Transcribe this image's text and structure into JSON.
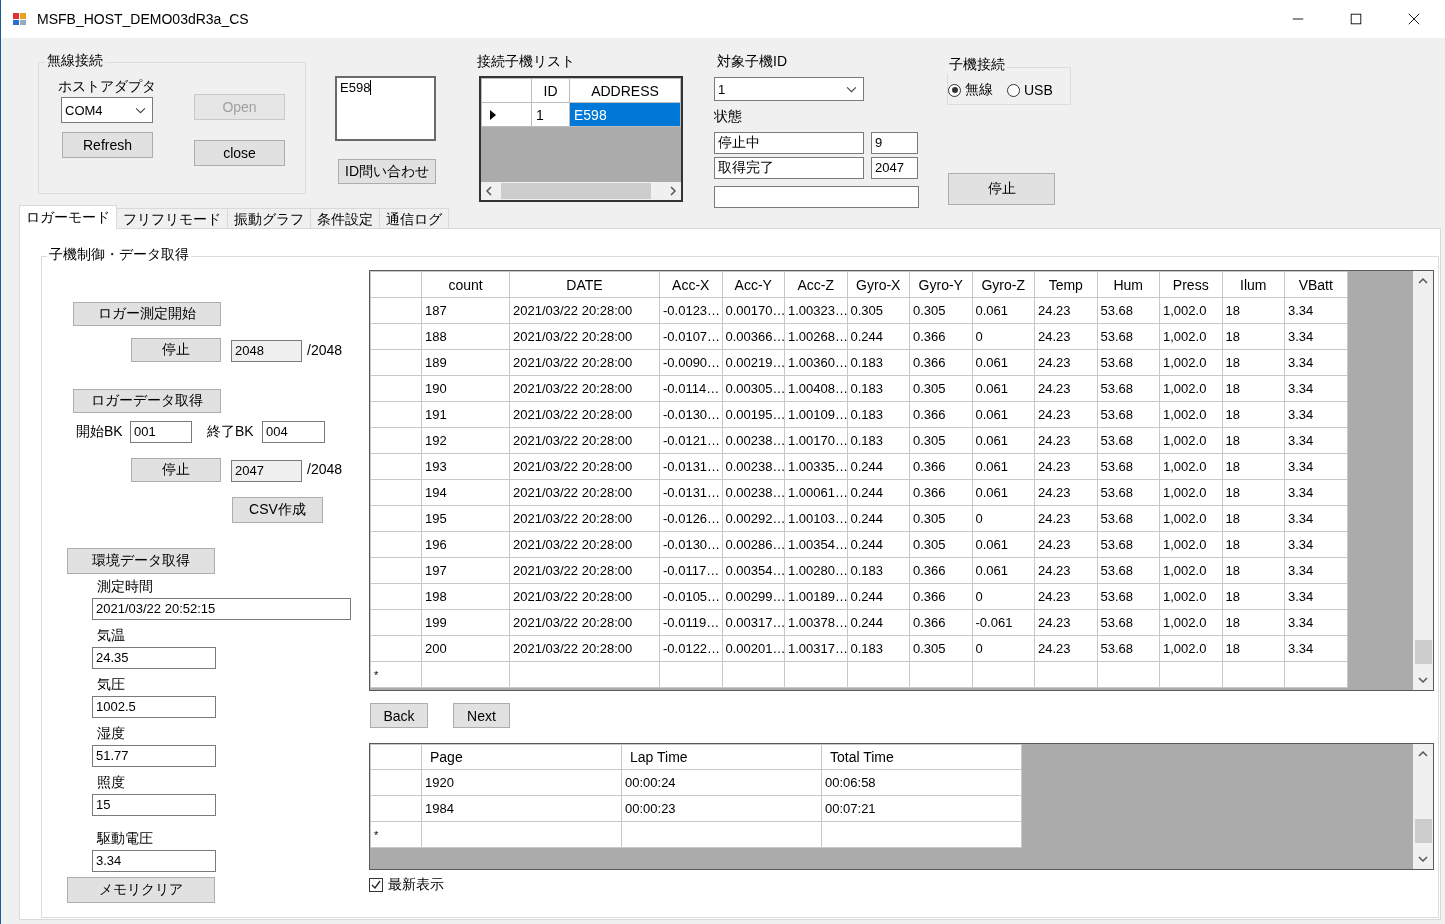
{
  "window": {
    "title": "MSFB_HOST_DEMO03dR3a_CS"
  },
  "wireless_group": {
    "title": "無線接続",
    "adapter_label": "ホストアダプタ",
    "port": "COM4",
    "refresh_button": "Refresh",
    "open_button": {
      "label": "Open",
      "disabled": true
    },
    "close_button": {
      "label": "close",
      "disabled": false
    }
  },
  "id_input": {
    "value": "E598"
  },
  "id_query_button": "ID問い合わせ",
  "device_list": {
    "title": "接続子機リスト",
    "columns": [
      "ID",
      "ADDRESS"
    ],
    "rows": [
      {
        "cells": [
          "1",
          "E598"
        ],
        "selected": true
      }
    ]
  },
  "target": {
    "label": "対象子機ID",
    "value": "1",
    "status_label": "状態",
    "status_fields": [
      {
        "text": "停止中",
        "count": "9"
      },
      {
        "text": "取得完了",
        "count": "2047"
      }
    ]
  },
  "connection": {
    "title": "子機接続",
    "options": [
      {
        "label": "無線",
        "selected": true
      },
      {
        "label": "USB",
        "selected": false
      }
    ]
  },
  "stop_button": "停止",
  "tabs": [
    {
      "label": "ロガーモード",
      "selected": true
    },
    {
      "label": "フリフリモード",
      "selected": false
    },
    {
      "label": "振動グラフ",
      "selected": false
    },
    {
      "label": "条件設定",
      "selected": false
    },
    {
      "label": "通信ログ",
      "selected": false
    }
  ],
  "logger": {
    "title": "子機制御・データ取得",
    "start_button": "ロガー測定開始",
    "stop_button_1": "停止",
    "progress_1": "2048",
    "total_1": "/2048",
    "fetch_button": "ロガーデータ取得",
    "start_bk_label": "開始BK",
    "start_bk": "001",
    "end_bk_label": "終了BK",
    "end_bk": "004",
    "stop_button_2": "停止",
    "progress_2": "2047",
    "total_2": "/2048",
    "csv_button": "CSV作成",
    "env_button": "環境データ取得",
    "env_fields": [
      {
        "label": "測定時間",
        "value": "2021/03/22 20:52:15",
        "kind": "wide"
      },
      {
        "label": "気温",
        "value": "24.35",
        "kind": "short"
      },
      {
        "label": "気圧",
        "value": "1002.5",
        "kind": "short"
      },
      {
        "label": "湿度",
        "value": "51.77",
        "kind": "short"
      },
      {
        "label": "照度",
        "value": "15",
        "kind": "short"
      },
      {
        "label": "駆動電圧",
        "value": "3.34",
        "kind": "short"
      }
    ],
    "clear_button": "メモリクリア"
  },
  "data_table": {
    "columns": [
      "count",
      "DATE",
      "Acc-X",
      "Acc-Y",
      "Acc-Z",
      "Gyro-X",
      "Gyro-Y",
      "Gyro-Z",
      "Temp",
      "Hum",
      "Press",
      "Ilum",
      "VBatt"
    ],
    "new_row_marker": "*",
    "rows": [
      [
        "187",
        "2021/03/22 20:28:00",
        "-0.0123…",
        "0.00170…",
        "1.00323…",
        "0.305",
        "0.305",
        "0.061",
        "24.23",
        "53.68",
        "1,002.0",
        "18",
        "3.34"
      ],
      [
        "188",
        "2021/03/22 20:28:00",
        "-0.0107…",
        "0.00366…",
        "1.00268…",
        "0.244",
        "0.366",
        "0",
        "24.23",
        "53.68",
        "1,002.0",
        "18",
        "3.34"
      ],
      [
        "189",
        "2021/03/22 20:28:00",
        "-0.0090…",
        "0.00219…",
        "1.00360…",
        "0.183",
        "0.366",
        "0.061",
        "24.23",
        "53.68",
        "1,002.0",
        "18",
        "3.34"
      ],
      [
        "190",
        "2021/03/22 20:28:00",
        "-0.0114…",
        "0.00305…",
        "1.00408…",
        "0.183",
        "0.305",
        "0.061",
        "24.23",
        "53.68",
        "1,002.0",
        "18",
        "3.34"
      ],
      [
        "191",
        "2021/03/22 20:28:00",
        "-0.0130…",
        "0.00195…",
        "1.00109…",
        "0.183",
        "0.366",
        "0.061",
        "24.23",
        "53.68",
        "1,002.0",
        "18",
        "3.34"
      ],
      [
        "192",
        "2021/03/22 20:28:00",
        "-0.0121…",
        "0.00238…",
        "1.00170…",
        "0.183",
        "0.305",
        "0.061",
        "24.23",
        "53.68",
        "1,002.0",
        "18",
        "3.34"
      ],
      [
        "193",
        "2021/03/22 20:28:00",
        "-0.0131…",
        "0.00238…",
        "1.00335…",
        "0.244",
        "0.366",
        "0.061",
        "24.23",
        "53.68",
        "1,002.0",
        "18",
        "3.34"
      ],
      [
        "194",
        "2021/03/22 20:28:00",
        "-0.0131…",
        "0.00238…",
        "1.00061…",
        "0.244",
        "0.366",
        "0.061",
        "24.23",
        "53.68",
        "1,002.0",
        "18",
        "3.34"
      ],
      [
        "195",
        "2021/03/22 20:28:00",
        "-0.0126…",
        "0.00292…",
        "1.00103…",
        "0.244",
        "0.305",
        "0",
        "24.23",
        "53.68",
        "1,002.0",
        "18",
        "3.34"
      ],
      [
        "196",
        "2021/03/22 20:28:00",
        "-0.0130…",
        "0.00286…",
        "1.00354…",
        "0.244",
        "0.305",
        "0.061",
        "24.23",
        "53.68",
        "1,002.0",
        "18",
        "3.34"
      ],
      [
        "197",
        "2021/03/22 20:28:00",
        "-0.0117…",
        "0.00354…",
        "1.00280…",
        "0.183",
        "0.366",
        "0.061",
        "24.23",
        "53.68",
        "1,002.0",
        "18",
        "3.34"
      ],
      [
        "198",
        "2021/03/22 20:28:00",
        "-0.0105…",
        "0.00299…",
        "1.00189…",
        "0.244",
        "0.366",
        "0",
        "24.23",
        "53.68",
        "1,002.0",
        "18",
        "3.34"
      ],
      [
        "199",
        "2021/03/22 20:28:00",
        "-0.0119…",
        "0.00317…",
        "1.00378…",
        "0.244",
        "0.366",
        "-0.061",
        "24.23",
        "53.68",
        "1,002.0",
        "18",
        "3.34"
      ],
      [
        "200",
        "2021/03/22 20:28:00",
        "-0.0122…",
        "0.00201…",
        "1.00317…",
        "0.183",
        "0.305",
        "0",
        "24.23",
        "53.68",
        "1,002.0",
        "18",
        "3.34"
      ]
    ]
  },
  "pager": {
    "back": "Back",
    "next": "Next"
  },
  "lap_table": {
    "columns": [
      "Page",
      "Lap Time",
      "Total Time"
    ],
    "new_row_marker": "*",
    "rows": [
      [
        "1920",
        "00:00:24",
        "00:06:58"
      ],
      [
        "1984",
        "00:00:23",
        "00:07:21"
      ]
    ]
  },
  "latest_checkbox": {
    "label": "最新表示",
    "checked": true
  }
}
